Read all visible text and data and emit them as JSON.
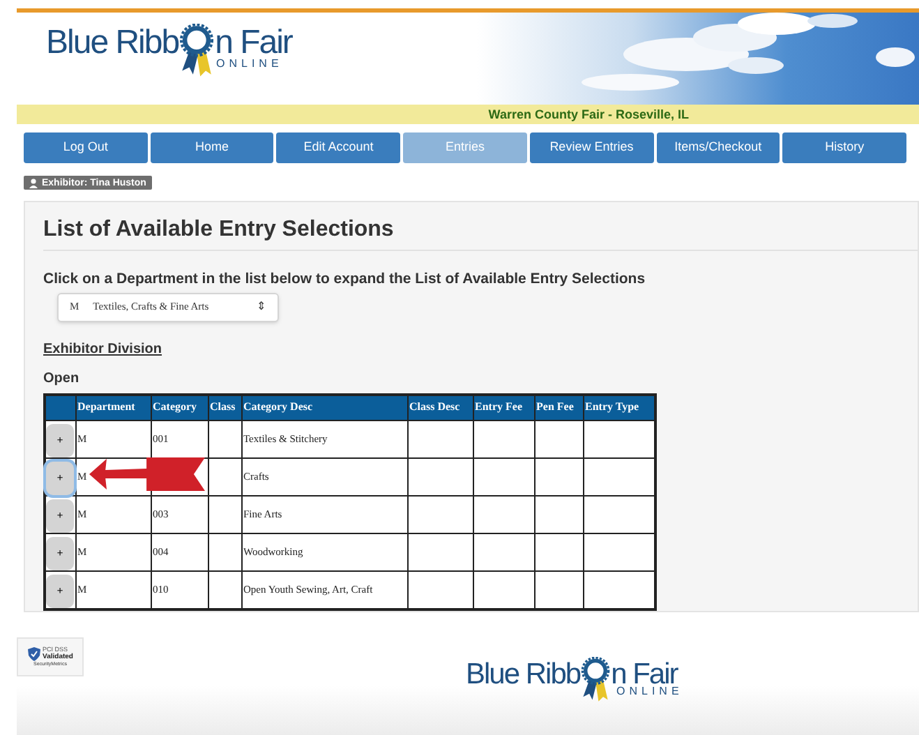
{
  "header": {
    "logo": {
      "before": "Blue Ribb",
      "after": "n Fair",
      "sub": "ONLINE"
    }
  },
  "fair_banner": "Warren County Fair - Roseville, IL",
  "nav": [
    {
      "label": "Log Out",
      "selected": false
    },
    {
      "label": "Home",
      "selected": false
    },
    {
      "label": "Edit Account",
      "selected": false
    },
    {
      "label": "Entries",
      "selected": true
    },
    {
      "label": "Review Entries",
      "selected": false
    },
    {
      "label": "Items/Checkout",
      "selected": false
    },
    {
      "label": "History",
      "selected": false
    }
  ],
  "exhibitor_badge": "Exhibitor: Tina Huston",
  "title": "List of Available Entry Selections",
  "instruction": "Click on a Department in the list below to expand the List of Available Entry Selections",
  "department_select": {
    "code": "M",
    "name": "Textiles, Crafts & Fine Arts",
    "arrows": "⇕"
  },
  "division_label": "Exhibitor Division",
  "division": "Open",
  "table": {
    "columns": [
      "Department",
      "Category",
      "Class",
      "Category Desc",
      "Class Desc",
      "Entry Fee",
      "Pen Fee",
      "Entry Type"
    ],
    "rows": [
      {
        "expand": "+",
        "focused": false,
        "cells": [
          "M",
          "001",
          "",
          "Textiles & Stitchery",
          "",
          "",
          "",
          ""
        ]
      },
      {
        "expand": "+",
        "focused": true,
        "cells": [
          "M",
          "",
          "",
          "Crafts",
          "",
          "",
          "",
          ""
        ]
      },
      {
        "expand": "+",
        "focused": false,
        "cells": [
          "M",
          "003",
          "",
          "Fine Arts",
          "",
          "",
          "",
          ""
        ]
      },
      {
        "expand": "+",
        "focused": false,
        "cells": [
          "M",
          "004",
          "",
          "Woodworking",
          "",
          "",
          "",
          ""
        ]
      },
      {
        "expand": "+",
        "focused": false,
        "cells": [
          "M",
          "010",
          "",
          "Open Youth Sewing, Art, Craft",
          "",
          "",
          "",
          ""
        ]
      }
    ]
  },
  "footer": {
    "security_badge": {
      "line_1": "PCI DSS",
      "line_2": "Validated",
      "line_3": "SecurityMetrics"
    },
    "logo": {
      "before": "Blue Ribb",
      "after": "n Fair",
      "sub": "ONLINE"
    }
  }
}
